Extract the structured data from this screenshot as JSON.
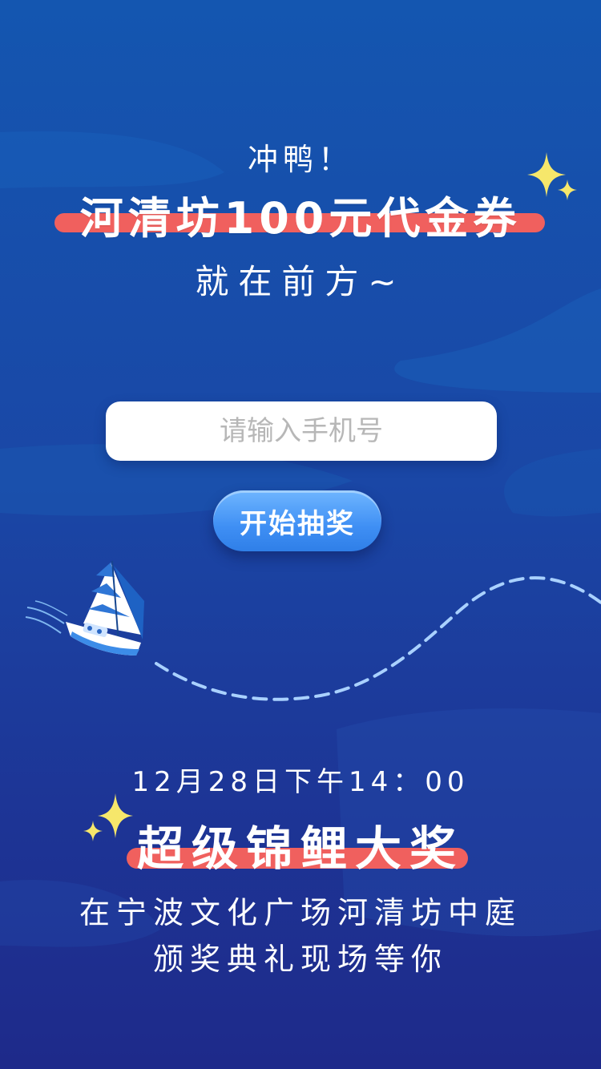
{
  "headline": {
    "top": "冲鸭！",
    "title": "河清坊100元代金券",
    "subtitle": "就在前方~"
  },
  "form": {
    "phone_placeholder": "请输入手机号",
    "phone_value": "",
    "start_button_label": "开始抽奖"
  },
  "event": {
    "datetime": "12月28日下午14：00",
    "prize_title": "超级锦鲤大奖",
    "venue_line1": "在宁波文化广场河清坊中庭",
    "venue_line2": "颁奖典礼现场等你"
  },
  "colors": {
    "background_top": "#1456b0",
    "background_bottom": "#1e2a8a",
    "highlight_bar": "#f0605e",
    "button": "#3f8ff4",
    "sparkle": "#f6e76b",
    "dashed_path": "#a9d1ff"
  },
  "icons": {
    "sparkle_top": "sparkle-icon",
    "sparkle_bottom": "sparkle-icon",
    "boat": "sailboat-illustration"
  }
}
